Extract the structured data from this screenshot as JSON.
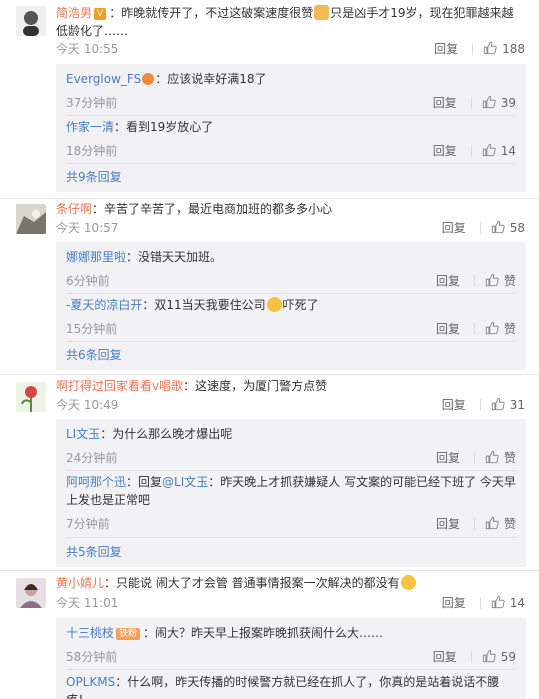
{
  "reply_label": "回复",
  "c1": {
    "user": "简浩男",
    "badge": "V",
    "text_a": "：昨晚就传开了，不过这破案速度很赞",
    "text_b": "只是凶手才19岁，现在犯罪越来越低龄化了……",
    "time": "今天 10:55",
    "likes": "188",
    "replies": [
      {
        "user": "Everglow_FS",
        "text": "：应该说幸好满18了",
        "time": "37分钟前",
        "likes": "39"
      },
      {
        "user": "作家一清",
        "text": "：看到19岁放心了",
        "time": "18分钟前",
        "likes": "14"
      }
    ],
    "more": "共9条回复"
  },
  "c2": {
    "user": "条仔啊",
    "text": "：辛苦了辛苦了，最近电商加班的都多多小心",
    "time": "今天 10:57",
    "likes": "58",
    "replies": [
      {
        "user": "娜娜那里啦",
        "text": "：没错天天加班。",
        "time": "6分钟前",
        "likes": "赞"
      },
      {
        "user": "-夏天的凉白开",
        "text": "：双11当天我要住公司",
        "text2": "吓死了",
        "time": "15分钟前",
        "likes": "赞"
      }
    ],
    "more": "共6条回复"
  },
  "c3": {
    "user": "啊打得过回家看看v唱歌",
    "text": "：这速度，为厦门警方点赞",
    "time": "今天 10:49",
    "likes": "31",
    "replies": [
      {
        "user": "LI文玉",
        "text": "：为什么那么晚才爆出呢",
        "time": "24分钟前",
        "likes": "赞"
      },
      {
        "user": "阿呵那个迅",
        "text_pre": "：回复",
        "mention": "@LI文玉",
        "text": "：昨天晚上才抓获嫌疑人 写文案的可能已经下班了 今天早上发也是正常吧",
        "time": "7分钟前",
        "likes": "赞"
      }
    ],
    "more": "共5条回复"
  },
  "c4": {
    "user": "黄小婧儿",
    "text": "：只能说 闹大了才会管 普通事情报案一次解决的都没有",
    "time": "今天 11:01",
    "likes": "14",
    "replies": [
      {
        "user": "十三桃枝",
        "badge": "铁粉",
        "text": "：闹大？昨天早上报案昨晚抓获闹什么大……",
        "time": "58分钟前",
        "likes": "59"
      },
      {
        "user": "OPLKMS",
        "text": "：什么啊，昨天传播的时候警方就已经在抓人了，你真的是站着说话不腰疼！"
      }
    ]
  },
  "colors": {
    "link": "#4a7cbf",
    "username": "#eb7350",
    "reply_bg": "#f2f2f5"
  }
}
